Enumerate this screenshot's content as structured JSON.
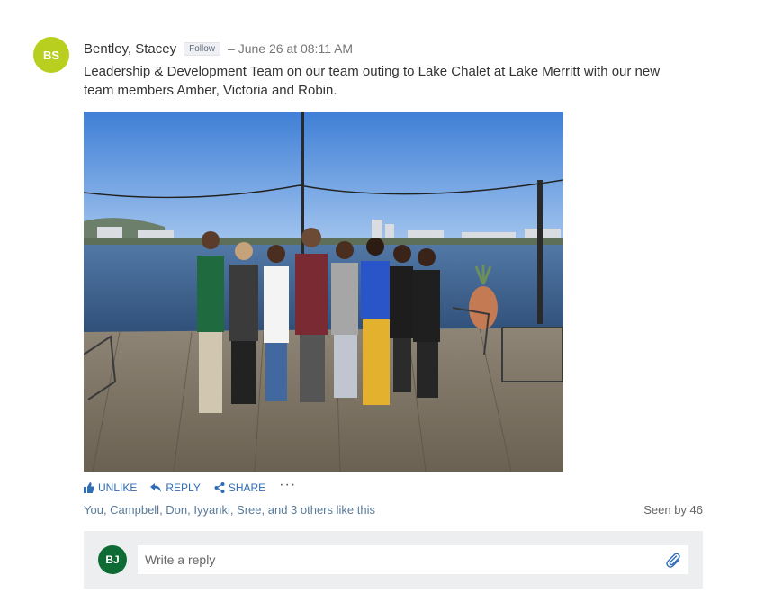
{
  "post": {
    "avatar_initials": "BS",
    "author": "Bentley, Stacey",
    "follow_label": "Follow",
    "timestamp": "– June 26 at 08:11 AM",
    "body": "Leadership & Development Team on our team outing to Lake Chalet at Lake Merritt with our new team members Amber, Victoria and Robin.",
    "photo_icon": "group-photo"
  },
  "actions": {
    "unlike_label": "UNLIKE",
    "reply_label": "REPLY",
    "share_label": "SHARE",
    "more_label": "···"
  },
  "likes_text": "You, Campbell, Don, Iyyanki, Sree, and 3 others like this",
  "seen_text": "Seen by 46",
  "reply": {
    "avatar_initials": "BJ",
    "placeholder": "Write a reply"
  },
  "colors": {
    "author_avatar": "#b8cf1f",
    "reply_avatar": "#0f6b34",
    "action_link": "#2f6db5"
  }
}
